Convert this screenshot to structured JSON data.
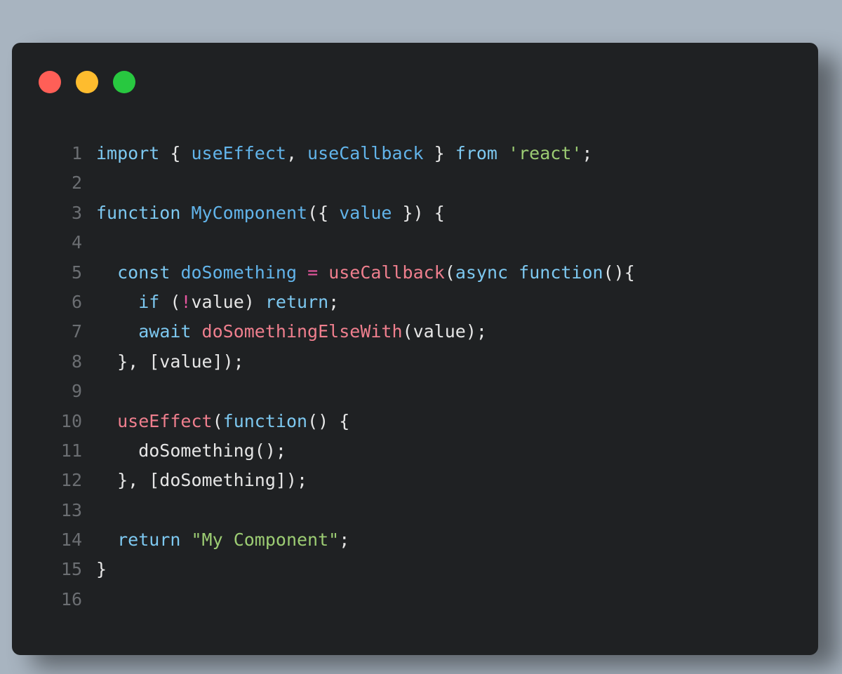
{
  "window_controls": [
    "close",
    "minimize",
    "zoom"
  ],
  "colors": {
    "background": "#a8b4c0",
    "editor": "#1f2123",
    "line_number": "#6b6e72",
    "plain": "#e6e6e6",
    "keyword": "#7dc8f0",
    "function_name": "#62b4ea",
    "call": "#ef7f8e",
    "operator": "#e4579e",
    "string": "#9ccc73"
  },
  "code": {
    "lines": [
      {
        "num": "1",
        "tokens": [
          {
            "t": "import",
            "c": "key"
          },
          {
            "t": " { ",
            "c": "plain"
          },
          {
            "t": "useEffect",
            "c": "fn"
          },
          {
            "t": ", ",
            "c": "plain"
          },
          {
            "t": "useCallback",
            "c": "fn"
          },
          {
            "t": " } ",
            "c": "plain"
          },
          {
            "t": "from",
            "c": "key"
          },
          {
            "t": " ",
            "c": "plain"
          },
          {
            "t": "'react'",
            "c": "str"
          },
          {
            "t": ";",
            "c": "plain"
          }
        ]
      },
      {
        "num": "2",
        "tokens": []
      },
      {
        "num": "3",
        "tokens": [
          {
            "t": "function",
            "c": "key"
          },
          {
            "t": " ",
            "c": "plain"
          },
          {
            "t": "MyComponent",
            "c": "fn"
          },
          {
            "t": "({ ",
            "c": "plain"
          },
          {
            "t": "value",
            "c": "fn"
          },
          {
            "t": " }) {",
            "c": "plain"
          }
        ]
      },
      {
        "num": "4",
        "tokens": []
      },
      {
        "num": "5",
        "tokens": [
          {
            "t": "  ",
            "c": "plain"
          },
          {
            "t": "const",
            "c": "key"
          },
          {
            "t": " ",
            "c": "plain"
          },
          {
            "t": "doSomething",
            "c": "fn"
          },
          {
            "t": " ",
            "c": "plain"
          },
          {
            "t": "=",
            "c": "op"
          },
          {
            "t": " ",
            "c": "plain"
          },
          {
            "t": "useCallback",
            "c": "call"
          },
          {
            "t": "(",
            "c": "plain"
          },
          {
            "t": "async",
            "c": "key"
          },
          {
            "t": " ",
            "c": "plain"
          },
          {
            "t": "function",
            "c": "key"
          },
          {
            "t": "(){",
            "c": "plain"
          }
        ]
      },
      {
        "num": "6",
        "tokens": [
          {
            "t": "    ",
            "c": "plain"
          },
          {
            "t": "if",
            "c": "key"
          },
          {
            "t": " (",
            "c": "plain"
          },
          {
            "t": "!",
            "c": "op"
          },
          {
            "t": "value) ",
            "c": "plain"
          },
          {
            "t": "return",
            "c": "key"
          },
          {
            "t": ";",
            "c": "plain"
          }
        ]
      },
      {
        "num": "7",
        "tokens": [
          {
            "t": "    ",
            "c": "plain"
          },
          {
            "t": "await",
            "c": "key"
          },
          {
            "t": " ",
            "c": "plain"
          },
          {
            "t": "doSomethingElseWith",
            "c": "call"
          },
          {
            "t": "(value);",
            "c": "plain"
          }
        ]
      },
      {
        "num": "8",
        "tokens": [
          {
            "t": "  }, [value]);",
            "c": "plain"
          }
        ]
      },
      {
        "num": "9",
        "tokens": []
      },
      {
        "num": "10",
        "tokens": [
          {
            "t": "  ",
            "c": "plain"
          },
          {
            "t": "useEffect",
            "c": "call"
          },
          {
            "t": "(",
            "c": "plain"
          },
          {
            "t": "function",
            "c": "key"
          },
          {
            "t": "() {",
            "c": "plain"
          }
        ]
      },
      {
        "num": "11",
        "tokens": [
          {
            "t": "    doSomething();",
            "c": "plain"
          }
        ]
      },
      {
        "num": "12",
        "tokens": [
          {
            "t": "  }, [doSomething]);",
            "c": "plain"
          }
        ]
      },
      {
        "num": "13",
        "tokens": []
      },
      {
        "num": "14",
        "tokens": [
          {
            "t": "  ",
            "c": "plain"
          },
          {
            "t": "return",
            "c": "key"
          },
          {
            "t": " ",
            "c": "plain"
          },
          {
            "t": "\"My Component\"",
            "c": "str"
          },
          {
            "t": ";",
            "c": "plain"
          }
        ]
      },
      {
        "num": "15",
        "tokens": [
          {
            "t": "}",
            "c": "plain"
          }
        ]
      },
      {
        "num": "16",
        "tokens": []
      }
    ]
  }
}
